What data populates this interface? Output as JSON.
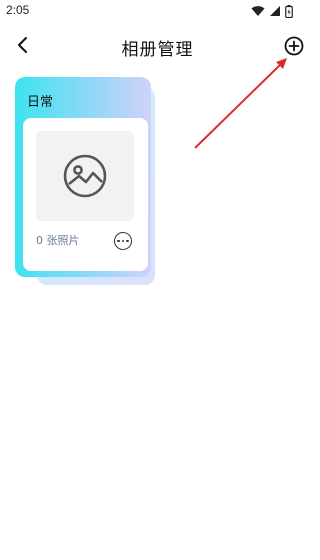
{
  "status_bar": {
    "time": "2:05",
    "icons": [
      "wifi-icon",
      "signal-icon",
      "battery-icon"
    ]
  },
  "header": {
    "title": "相册管理",
    "back_icon": "back-arrow-icon",
    "add_icon": "add-circle-icon"
  },
  "albums": [
    {
      "name": "日常",
      "photo_count_label": "0 张照片",
      "thumbnail_icon": "image-placeholder-icon",
      "more_icon": "more-options-icon"
    }
  ],
  "colors": {
    "card_gradient_start": "#3de3f0",
    "card_gradient_end": "#d0d2fb",
    "annotation_arrow": "#e0282e",
    "count_text": "#6a7a9a"
  }
}
